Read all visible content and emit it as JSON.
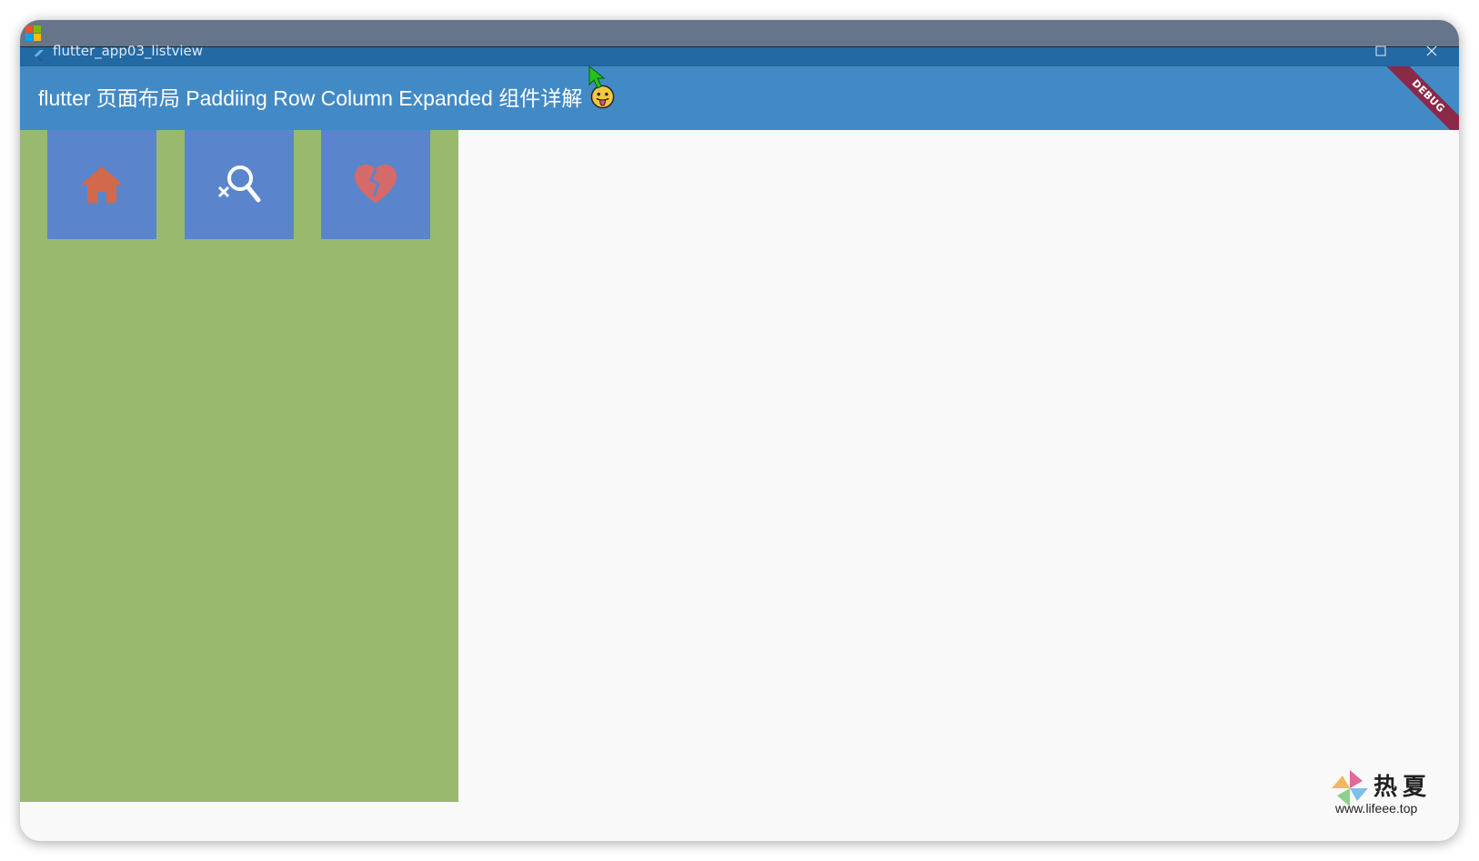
{
  "window": {
    "title": "flutter_app03_listview",
    "minimize_icon": "minimize-icon",
    "maximize_icon": "maximize-icon",
    "close_icon": "close-icon"
  },
  "appbar": {
    "title": "flutter 页面布局 Paddiing Row Column Expanded 组件详解",
    "emoji": "tongue-face-emoji",
    "color": "#428ac6"
  },
  "debug_banner": {
    "label": "DEBUG",
    "color": "#8a2a48"
  },
  "sidebar": {
    "color": "#99b96e",
    "tiles": [
      {
        "icon": "home-icon",
        "icon_color": "#d1694a",
        "bg": "#5a85cc"
      },
      {
        "icon": "search-off-icon",
        "icon_color": "#ffffff",
        "bg": "#5a85cc"
      },
      {
        "icon": "heart-broken-icon",
        "icon_color": "#d56a6a",
        "bg": "#5a85cc"
      }
    ]
  },
  "watermark": {
    "chinese": "热夏",
    "url": "www.lifeee.top"
  }
}
